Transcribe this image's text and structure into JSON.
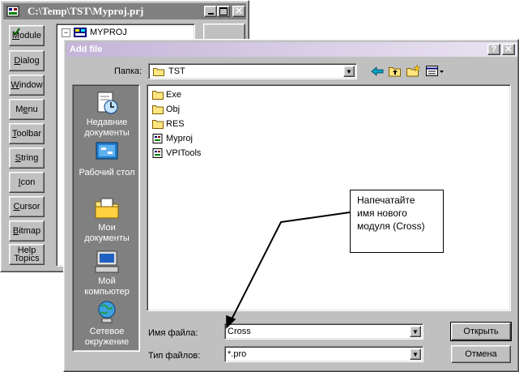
{
  "project_window": {
    "title": "C:\\Temp\\TST\\Myproj.prj",
    "buttons": [
      {
        "label": "Module",
        "accel": "M",
        "rest": "odule"
      },
      {
        "label": "Dialog",
        "accel": "D",
        "rest": "ialog"
      },
      {
        "label": "Window",
        "accel": "W",
        "rest": "indow"
      },
      {
        "label": "Menu",
        "accel": "e",
        "pre": "M",
        "rest": "nu"
      },
      {
        "label": "Toolbar",
        "accel": "T",
        "rest": "oolbar"
      },
      {
        "label": "String",
        "accel": "S",
        "rest": "tring"
      },
      {
        "label": "Icon",
        "accel": "I",
        "rest": "con"
      },
      {
        "label": "Cursor",
        "accel": "C",
        "rest": "ursor"
      },
      {
        "label": "Bitmap",
        "accel": "B",
        "rest": "itmap"
      },
      {
        "label1": "Help",
        "label2": "Topics"
      }
    ],
    "tree_root": "MYPROJ"
  },
  "dialog": {
    "title": "Add file",
    "folder_label": "Папка:",
    "folder_value": "TST",
    "places": [
      {
        "line1": "Недавние",
        "line2": "документы",
        "icon": "recent-docs-icon"
      },
      {
        "line1": "Рабочий стол",
        "line2": "",
        "icon": "desktop-icon"
      },
      {
        "line1": "Мои",
        "line2": "документы",
        "icon": "my-documents-icon"
      },
      {
        "line1": "Мой",
        "line2": "компьютер",
        "icon": "my-computer-icon"
      },
      {
        "line1": "Сетевое",
        "line2": "окружение",
        "icon": "network-icon"
      }
    ],
    "files": [
      {
        "name": "Exe",
        "type": "folder"
      },
      {
        "name": "Obj",
        "type": "folder"
      },
      {
        "name": "RES",
        "type": "folder"
      },
      {
        "name": "Myproj",
        "type": "file"
      },
      {
        "name": "VPITools",
        "type": "file"
      }
    ],
    "filename_label": "Имя файла:",
    "filename_value": "Cross",
    "filetype_label": "Тип файлов:",
    "filetype_value": "*.pro",
    "open_button": "Открыть",
    "cancel_button": "Отмена",
    "help_glyph": "?",
    "close_glyph": "✕"
  },
  "callout": {
    "line1": "Напечатайте",
    "line2": "имя нового",
    "line3": "модуля (Cross)"
  }
}
